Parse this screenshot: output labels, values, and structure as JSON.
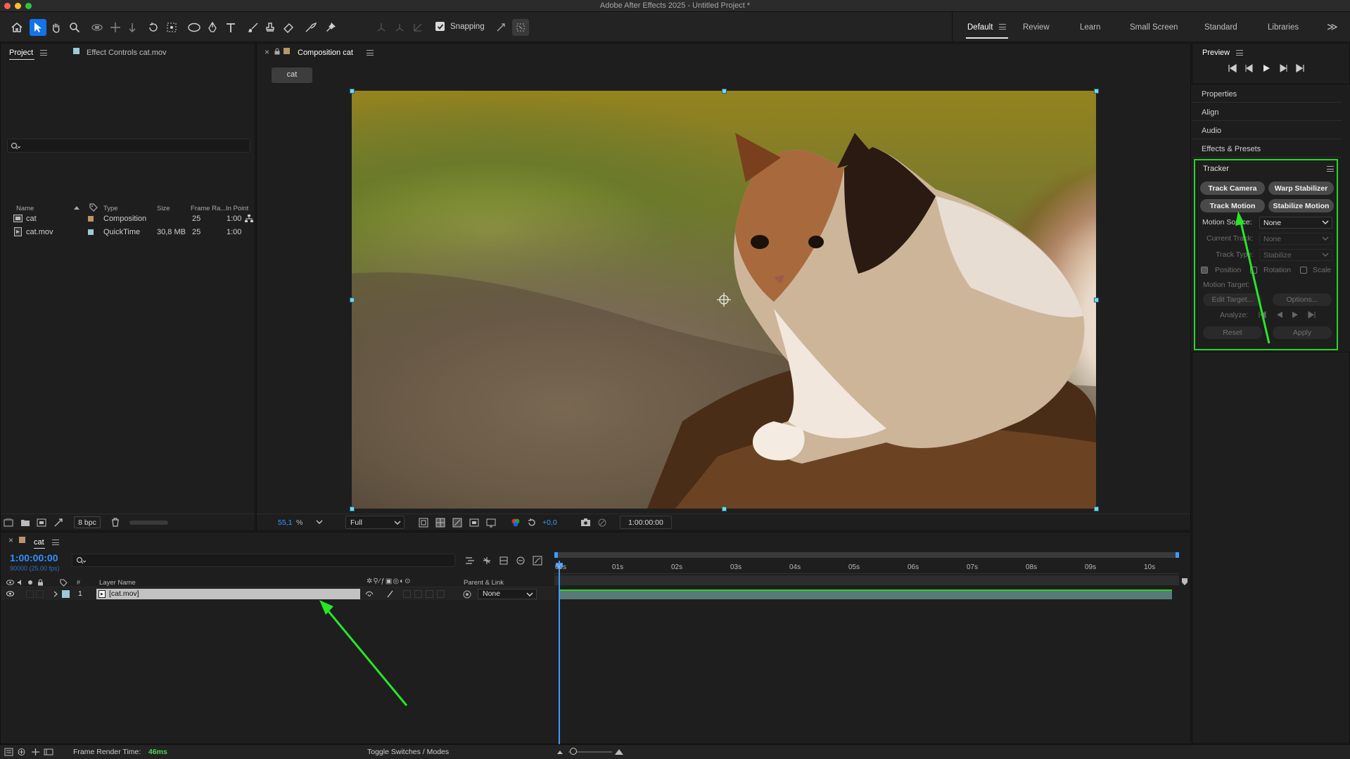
{
  "window": {
    "title": "Adobe After Effects 2025 - Untitled Project *"
  },
  "toolbar": {
    "snapping_label": "Snapping",
    "workspaces": [
      "Default",
      "Review",
      "Learn",
      "Small Screen",
      "Standard",
      "Libraries"
    ],
    "active_workspace": "Default",
    "overflow_glyph": "≫",
    "icons": [
      "home-icon",
      "selection-tool-icon",
      "hand-tool-icon",
      "zoom-tool-icon",
      "orbit-camera-icon",
      "pan-camera-icon",
      "dolly-camera-icon",
      "rotation-tool-icon",
      "pan-behind-icon",
      "ellipse-tool-icon",
      "pen-tool-icon",
      "type-tool-icon",
      "brush-tool-icon",
      "clone-stamp-icon",
      "eraser-icon",
      "roto-brush-icon",
      "puppet-pin-icon"
    ]
  },
  "project_panel": {
    "tab_project": "Project",
    "tab_effect_controls": "Effect Controls cat.mov",
    "columns": [
      "Name",
      "Type",
      "Size",
      "Frame Ra...",
      "In Point"
    ],
    "items": [
      {
        "name": "cat",
        "type": "Composition",
        "size": "",
        "fps": "25",
        "in_point": "1:00",
        "color": "#b8956a"
      },
      {
        "name": "cat.mov",
        "type": "QuickTime",
        "size": "30,8 MB",
        "fps": "25",
        "in_point": "1:00",
        "color": "#9ecbd4"
      }
    ],
    "bpc": "8 bpc"
  },
  "comp_panel": {
    "tab_label": "Composition cat",
    "comp_button": "cat",
    "zoom": "55,1",
    "zoom_unit": "%",
    "resolution": "Full",
    "exposure": "+0,0",
    "timecode": "1:00:00:00"
  },
  "right_panel": {
    "preview_label": "Preview",
    "items": [
      "Properties",
      "Align",
      "Audio",
      "Effects & Presets"
    ],
    "tracker": {
      "title": "Tracker",
      "buttons": [
        "Track Camera",
        "Warp Stabilizer",
        "Track Motion",
        "Stabilize Motion"
      ],
      "motion_source_label": "Motion Source:",
      "motion_source_value": "None",
      "current_track_label": "Current Track:",
      "current_track_value": "None",
      "track_type_label": "Track Type:",
      "track_type_value": "Stabilize",
      "checks": [
        "Position",
        "Rotation",
        "Scale"
      ],
      "motion_target_label": "Motion Target:",
      "edit_target": "Edit Target...",
      "options": "Options...",
      "analyze_label": "Analyze:",
      "reset": "Reset",
      "apply": "Apply"
    }
  },
  "timeline": {
    "comp_tab": "cat",
    "timecode": "1:00:00:00",
    "timecode_sub": "90000 (25.00 fps)",
    "layer_name_header": "Layer Name",
    "num_header": "#",
    "parent_header": "Parent & Link",
    "layer": {
      "num": "1",
      "name": "[cat.mov]",
      "parent": "None"
    },
    "ruler": [
      "00s",
      "01s",
      "02s",
      "03s",
      "04s",
      "05s",
      "06s",
      "07s",
      "08s",
      "09s",
      "10s"
    ],
    "toggle_label": "Toggle Switches / Modes"
  },
  "statusbar": {
    "render_label": "Frame Render Time:",
    "render_value": "46ms"
  },
  "colors": {
    "accent": "#1473e6",
    "highlight_green": "#27d627",
    "timecode_blue": "#2f8fff"
  }
}
